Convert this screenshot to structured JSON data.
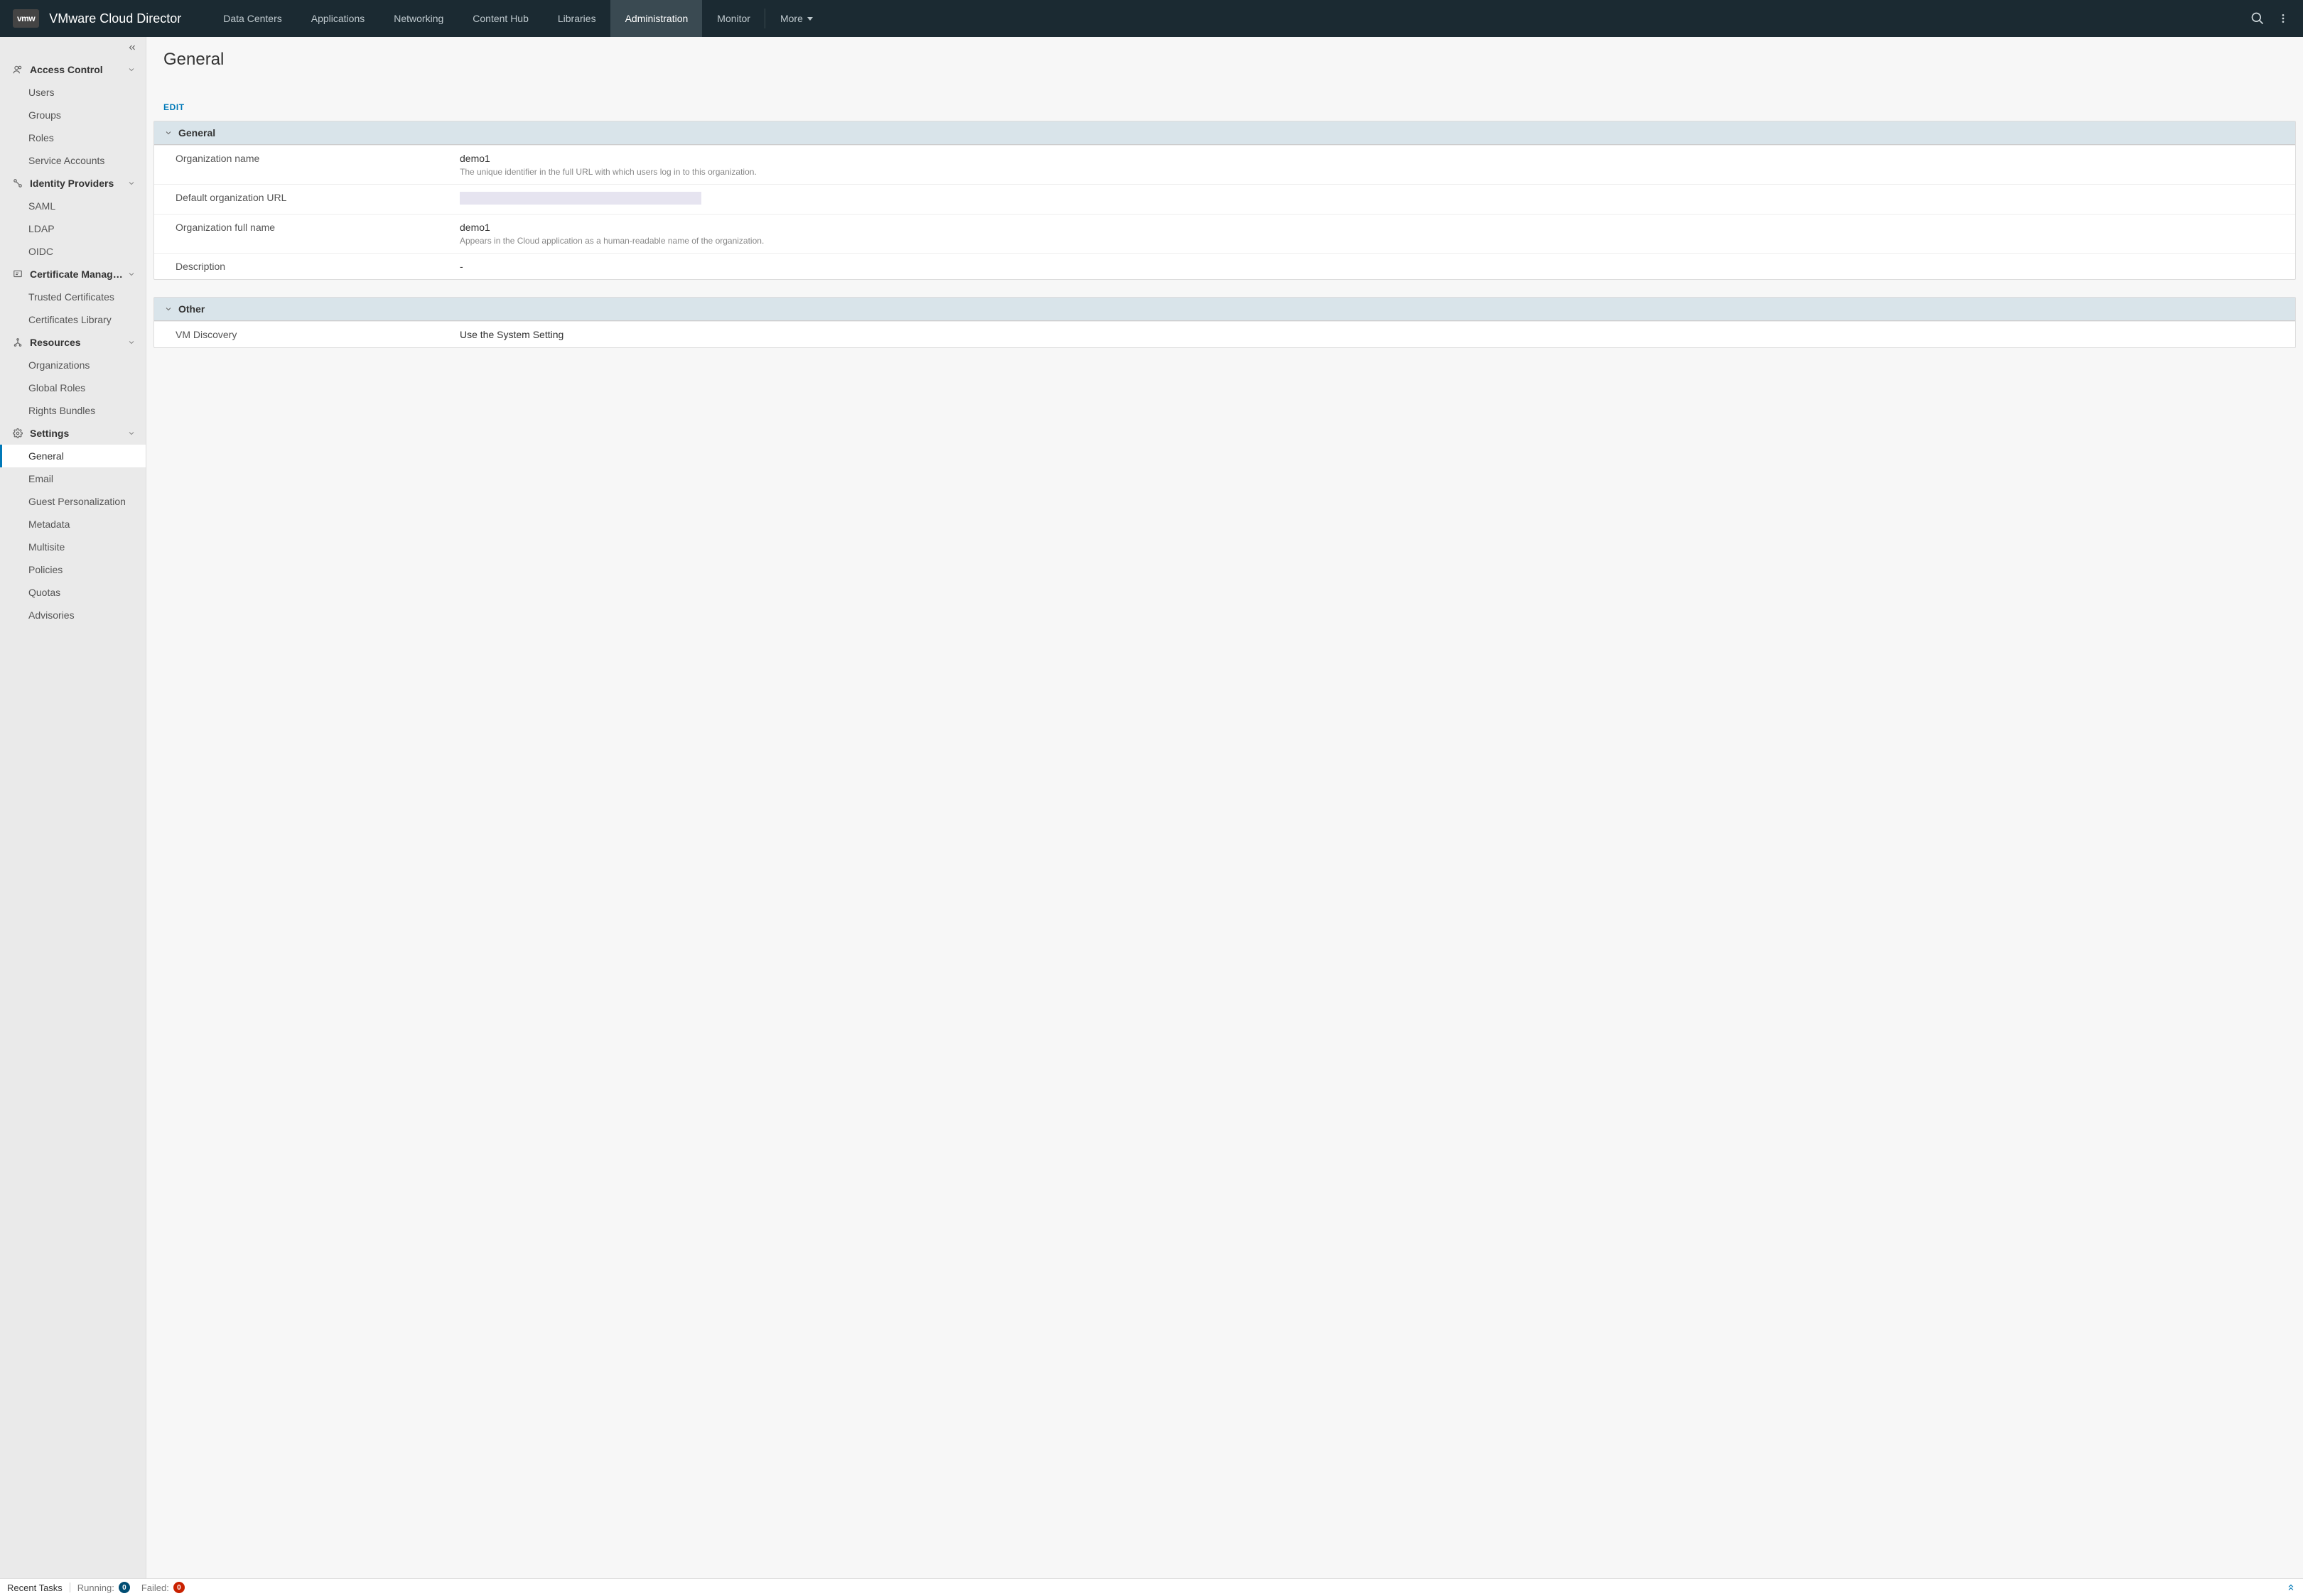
{
  "brand": {
    "logo": "vmw",
    "title": "VMware Cloud Director"
  },
  "nav": {
    "tabs": [
      "Data Centers",
      "Applications",
      "Networking",
      "Content Hub",
      "Libraries",
      "Administration",
      "Monitor"
    ],
    "active": "Administration",
    "more": "More"
  },
  "sidebar": {
    "groups": [
      {
        "id": "access-control",
        "label": "Access Control",
        "icon": "users",
        "items": [
          "Users",
          "Groups",
          "Roles",
          "Service Accounts"
        ]
      },
      {
        "id": "identity-providers",
        "label": "Identity Providers",
        "icon": "link",
        "items": [
          "SAML",
          "LDAP",
          "OIDC"
        ]
      },
      {
        "id": "certificate-management",
        "label": "Certificate Managem…",
        "icon": "cert",
        "items": [
          "Trusted Certificates",
          "Certificates Library"
        ]
      },
      {
        "id": "resources",
        "label": "Resources",
        "icon": "tree",
        "items": [
          "Organizations",
          "Global Roles",
          "Rights Bundles"
        ]
      },
      {
        "id": "settings",
        "label": "Settings",
        "icon": "gear",
        "items": [
          "General",
          "Email",
          "Guest Personalization",
          "Metadata",
          "Multisite",
          "Policies",
          "Quotas",
          "Advisories"
        ],
        "activeItem": "General"
      }
    ]
  },
  "page": {
    "title": "General",
    "edit": "EDIT",
    "panels": {
      "general": {
        "title": "General",
        "rows": [
          {
            "label": "Organization name",
            "value": "demo1",
            "help": "The unique identifier in the full URL with which users log in to this organization."
          },
          {
            "label": "Default organization URL",
            "redacted": true
          },
          {
            "label": "Organization full name",
            "value": "demo1",
            "help": "Appears in the Cloud application as a human-readable name of the organization."
          },
          {
            "label": "Description",
            "value": "-"
          }
        ]
      },
      "other": {
        "title": "Other",
        "rows": [
          {
            "label": "VM Discovery",
            "value": "Use the System Setting"
          }
        ]
      }
    }
  },
  "footer": {
    "recent": "Recent Tasks",
    "running_label": "Running:",
    "running_count": "0",
    "failed_label": "Failed:",
    "failed_count": "0"
  }
}
